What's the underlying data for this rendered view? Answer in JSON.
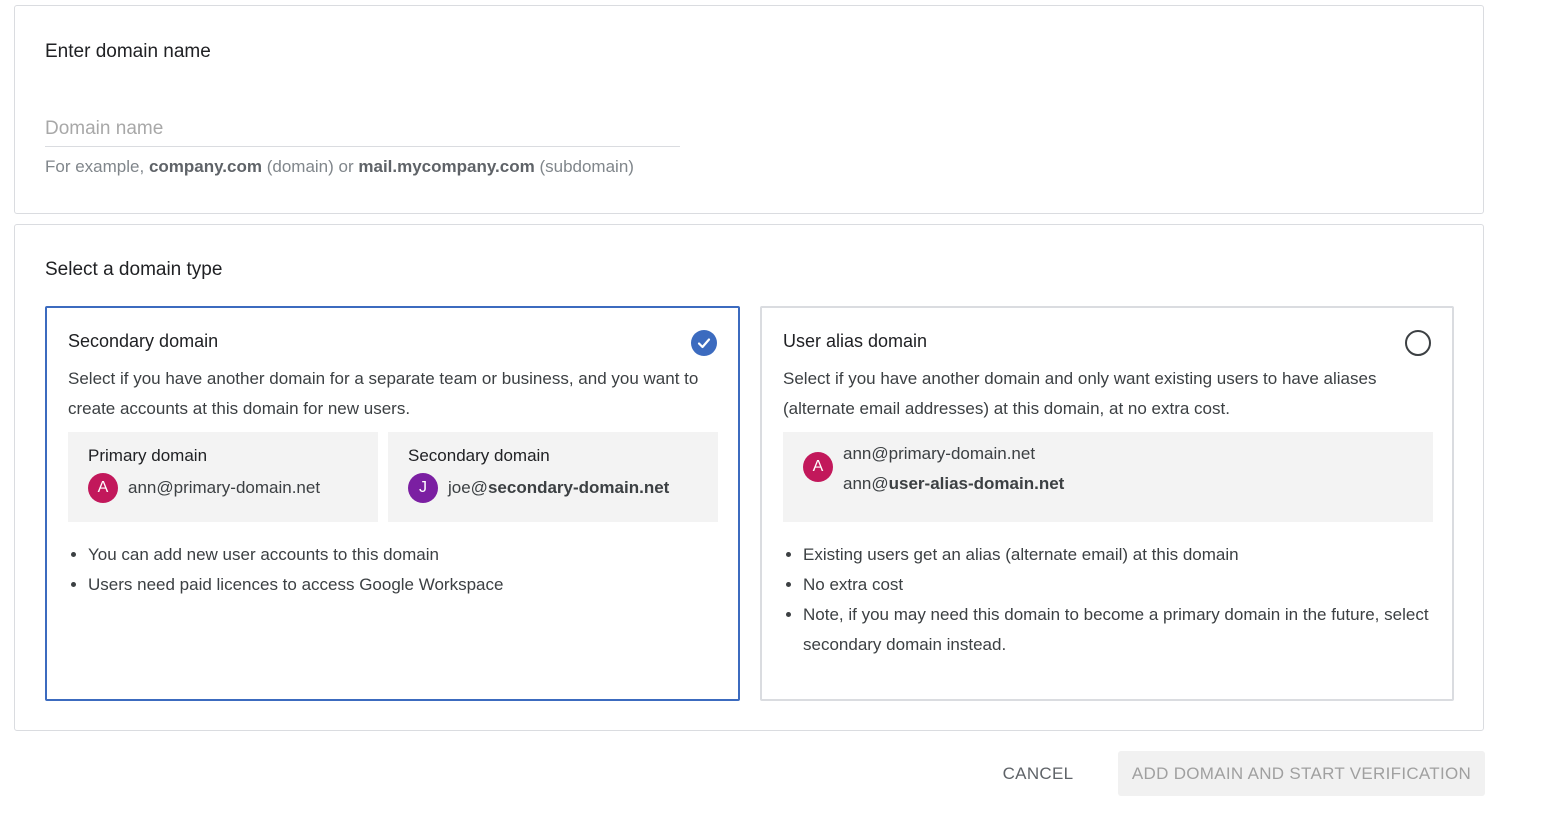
{
  "domain_card": {
    "title": "Enter domain name",
    "input_placeholder": "Domain name",
    "input_value": "",
    "hint": {
      "prefix": "For example, ",
      "example1": "company.com",
      "example1_note": " (domain) or ",
      "example2": "mail.mycompany.com",
      "example2_note": " (subdomain)"
    }
  },
  "type_card": {
    "title": "Select a domain type",
    "options": [
      {
        "title": "Secondary domain",
        "selected": true,
        "description": "Select if you have another domain for a separate team or business, and you want to create accounts at this domain for new users.",
        "examples": [
          {
            "label": "Primary domain",
            "avatar_letter": "A",
            "email_user": "ann@",
            "email_domain": "primary-domain.net"
          },
          {
            "label": "Secondary domain",
            "avatar_letter": "J",
            "email_user": "joe@",
            "email_domain": "secondary-domain.net"
          }
        ],
        "bullets": [
          "You can add new user accounts to this domain",
          "Users need paid licences to access Google Workspace"
        ]
      },
      {
        "title": "User alias domain",
        "selected": false,
        "description": "Select if you have another domain and only want existing users to have aliases (alternate email addresses) at this domain, at no extra cost.",
        "example": {
          "avatar_letter": "A",
          "line1": "ann@primary-domain.net",
          "line2_user": "ann@",
          "line2_domain": "user-alias-domain.net"
        },
        "bullets": [
          "Existing users get an alias (alternate email) at this domain",
          "No extra cost",
          "Note, if you may need this domain to become a primary domain in the future, select secondary domain instead."
        ]
      }
    ]
  },
  "actions": {
    "cancel": "CANCEL",
    "add": "ADD DOMAIN AND START VERIFICATION"
  },
  "colors": {
    "selected_border": "#3c6bbf",
    "avatar_a": "#c2185b",
    "avatar_j": "#7b1fa2"
  },
  "icons": {
    "selected": "check-circle-icon",
    "unselected": "radio-unchecked-icon"
  }
}
